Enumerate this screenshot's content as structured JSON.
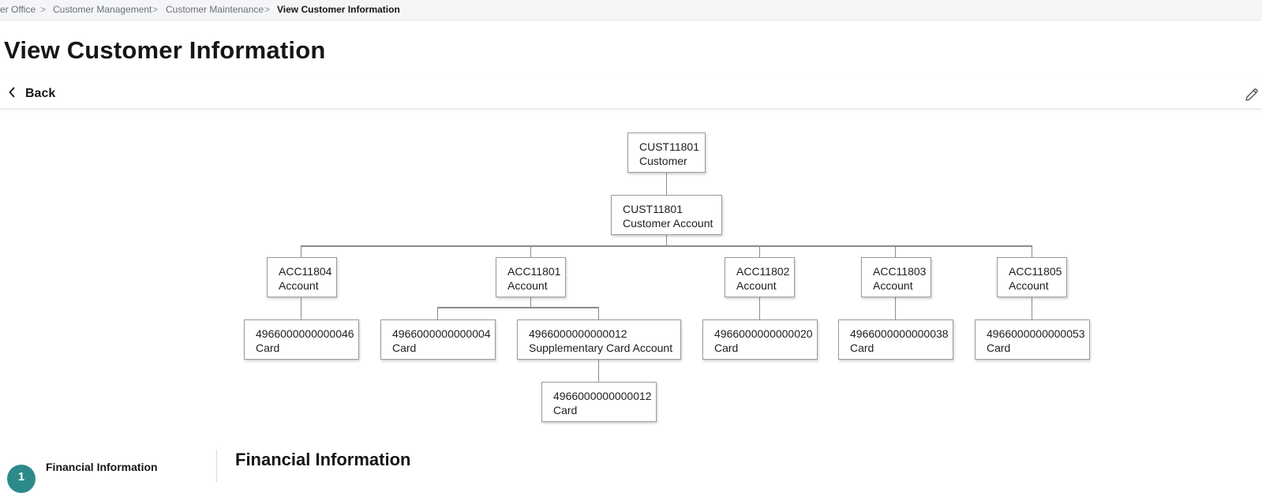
{
  "breadcrumb": {
    "items": [
      "er Office",
      "Customer Management",
      "Customer Maintenance",
      "View Customer Information"
    ],
    "separator": ">"
  },
  "page": {
    "title": "View Customer Information",
    "back_label": "Back"
  },
  "icons": {
    "back": "chevron-left-icon",
    "edit": "pencil-icon"
  },
  "tree": {
    "customer": {
      "id": "CUST11801",
      "type": "Customer"
    },
    "cust_account": {
      "id": "CUST11801",
      "type": "Customer Account"
    },
    "accounts": [
      {
        "id": "ACC11804",
        "type": "Account"
      },
      {
        "id": "ACC11801",
        "type": "Account"
      },
      {
        "id": "ACC11802",
        "type": "Account"
      },
      {
        "id": "ACC11803",
        "type": "Account"
      },
      {
        "id": "ACC11805",
        "type": "Account"
      }
    ],
    "cards": [
      {
        "id": "4966000000000046",
        "type": "Card"
      },
      {
        "id": "4966000000000004",
        "type": "Card"
      },
      {
        "id": "4966000000000012",
        "type": "Supplementary Card Account"
      },
      {
        "id": "4966000000000020",
        "type": "Card"
      },
      {
        "id": "4966000000000038",
        "type": "Card"
      },
      {
        "id": "4966000000000053",
        "type": "Card"
      }
    ],
    "supp_card": {
      "id": "4966000000000012",
      "type": "Card"
    }
  },
  "section": {
    "step_number": "1",
    "step_label": "Financial Information",
    "title": "Financial Information"
  },
  "colors": {
    "accent": "#2d8a8a",
    "connector": "#8c8c8c",
    "node_border": "#9a9a9a"
  }
}
